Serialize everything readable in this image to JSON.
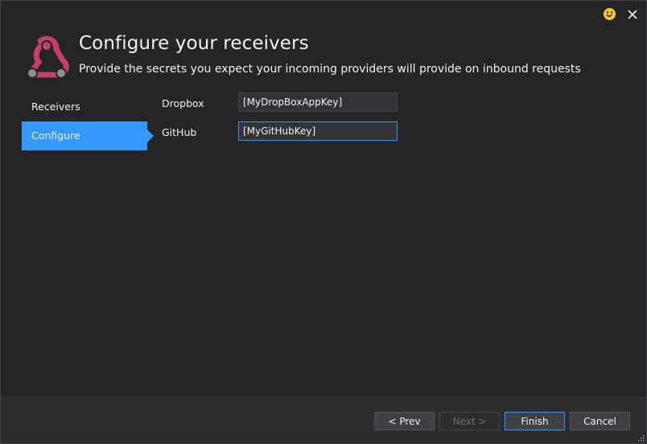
{
  "header": {
    "title": "Configure your receivers",
    "subtitle": "Provide the secrets you expect your incoming providers will provide on inbound requests"
  },
  "titlebar": {
    "icons": [
      "smiley-feedback-icon",
      "close-icon"
    ]
  },
  "sidebar": {
    "items": [
      {
        "label": "Receivers",
        "active": false
      },
      {
        "label": "Configure",
        "active": true
      }
    ]
  },
  "form": {
    "fields": [
      {
        "label": "Dropbox",
        "value": "[MyDropBoxAppKey]",
        "focused": false
      },
      {
        "label": "GitHub",
        "value": "[MyGitHubKey]",
        "focused": true
      }
    ]
  },
  "footer": {
    "prev_label": "< Prev",
    "next_label": "Next >",
    "finish_label": "Finish",
    "cancel_label": "Cancel"
  },
  "colors": {
    "accent": "#3399ff",
    "background": "#252526",
    "footer": "#2d2d30",
    "logo": "#c2406a"
  }
}
